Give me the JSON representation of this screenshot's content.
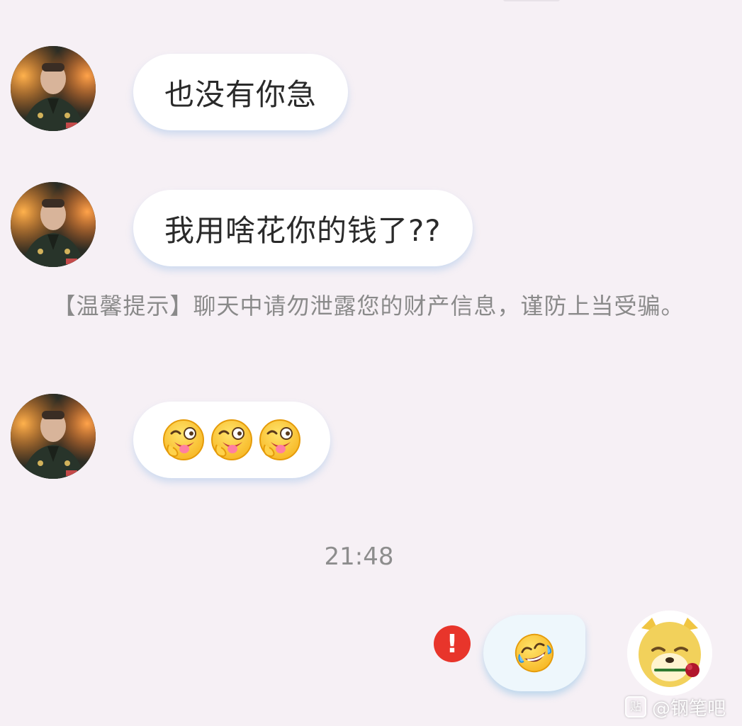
{
  "messages": [
    {
      "sender": "contact",
      "text": "也没有你急"
    },
    {
      "sender": "contact",
      "text": "我用啥花你的钱了??"
    },
    {
      "sender": "contact",
      "emoji_count": 3,
      "emoji": "laughing-face-tongue-wink"
    }
  ],
  "system_notice": {
    "text": "【温馨提示】聊天中请勿泄露您的财产信息，谨防上当受骗。"
  },
  "timestamp": "21:48",
  "outgoing": {
    "emoji": "rofl-face",
    "status": "failed",
    "status_symbol": "!"
  },
  "watermark": {
    "text": "@钢笔吧",
    "logo": "贴"
  },
  "colors": {
    "background": "#f6f0f5",
    "bubble_incoming": "#ffffff",
    "bubble_outgoing": "#eef7fc",
    "error": "#e8352b",
    "muted_text": "#8a8a8a"
  }
}
